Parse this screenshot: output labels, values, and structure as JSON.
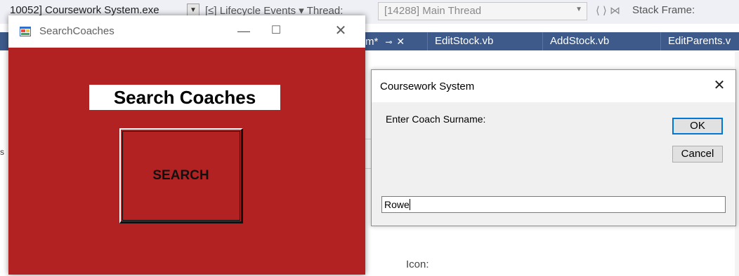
{
  "ide": {
    "toolbar": {
      "process": "10052] Coursework System.exe",
      "lifecycle": "[≤] Lifecycle Events ▾ Thread:",
      "thread_value": "[14288] Main Thread",
      "stack_frame": "Stack Frame:"
    },
    "tabs": [
      {
        "label": "m*"
      },
      {
        "label": "EditStock.vb"
      },
      {
        "label": "AddStock.vb"
      },
      {
        "label": "EditParents.v"
      }
    ],
    "icon_label": "Icon:",
    "left_fragment": "s"
  },
  "search_window": {
    "title": "SearchCoaches",
    "heading": "Search Coaches",
    "search_button": "SEARCH",
    "back_color": "#b22222"
  },
  "input_dialog": {
    "title": "Coursework System",
    "prompt": "Enter Coach Surname:",
    "ok_label": "OK",
    "cancel_label": "Cancel",
    "input_value": "Rowe"
  },
  "colors": {
    "ide_tab_bar": "#3e5a8a",
    "focus_blue": "#0078d7"
  }
}
